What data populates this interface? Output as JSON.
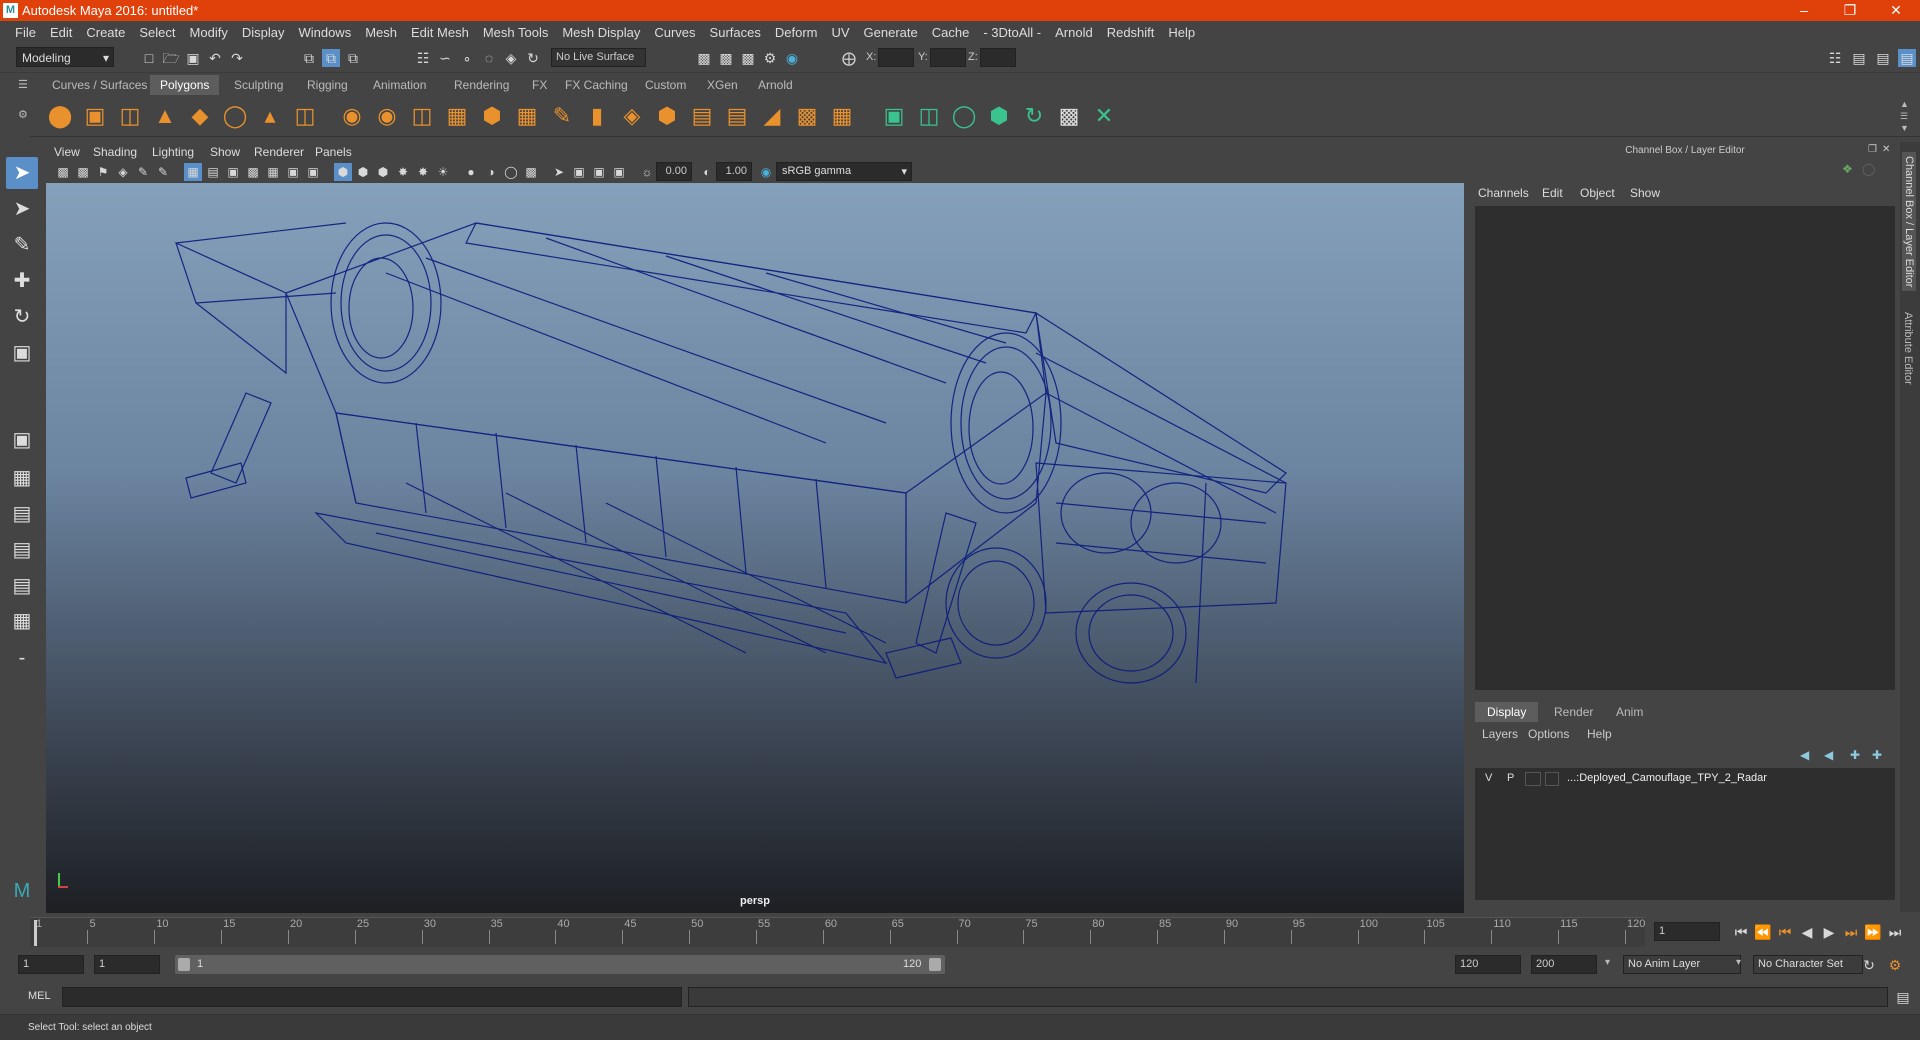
{
  "window": {
    "title": "Autodesk Maya 2016: untitled*",
    "logo": "M"
  },
  "menu": [
    "File",
    "Edit",
    "Create",
    "Select",
    "Modify",
    "Display",
    "Windows",
    "Mesh",
    "Edit Mesh",
    "Mesh Tools",
    "Mesh Display",
    "Curves",
    "Surfaces",
    "Deform",
    "UV",
    "Generate",
    "Cache",
    "- 3DtoAll -",
    "Arnold",
    "Redshift",
    "Help"
  ],
  "status_line": {
    "mode": "Modeling",
    "live_surface": "No Live Surface",
    "x_label": "X:",
    "y_label": "Y:",
    "z_label": "Z:"
  },
  "shelf_tabs": [
    "Curves / Surfaces",
    "Polygons",
    "Sculpting",
    "Rigging",
    "Animation",
    "Rendering",
    "FX",
    "FX Caching",
    "Custom",
    "XGen",
    "Arnold"
  ],
  "active_shelf": "Polygons",
  "viewport": {
    "menu": [
      "View",
      "Shading",
      "Lighting",
      "Show",
      "Renderer",
      "Panels"
    ],
    "exposure": "0.00",
    "gamma": "1.00",
    "color_space": "sRGB gamma",
    "camera": "persp"
  },
  "channel_box": {
    "title": "Channel Box / Layer Editor",
    "menu": [
      "Channels",
      "Edit",
      "Object",
      "Show"
    ],
    "layer_tabs": [
      "Display",
      "Render",
      "Anim"
    ],
    "active_layer_tab": "Display",
    "layer_menu": [
      "Layers",
      "Options",
      "Help"
    ],
    "layer": {
      "v": "V",
      "p": "P",
      "name": "...:Deployed_Camouflage_TPY_2_Radar"
    }
  },
  "side_tabs": [
    "Channel Box / Layer Editor",
    "Attribute Editor"
  ],
  "timeline": {
    "ticks": [
      "1",
      "5",
      "10",
      "15",
      "20",
      "25",
      "30",
      "35",
      "40",
      "45",
      "50",
      "55",
      "60",
      "65",
      "70",
      "75",
      "80",
      "85",
      "90",
      "95",
      "100",
      "105",
      "110",
      "115",
      "120"
    ],
    "current_frame": "1"
  },
  "range": {
    "start": "1",
    "inner_start": "1",
    "slider_start": "1",
    "slider_end": "120",
    "end": "120",
    "max": "200",
    "anim_layer": "No Anim Layer",
    "char_set": "No Character Set"
  },
  "mel": {
    "label": "MEL"
  },
  "help_line": "Select Tool: select an object"
}
